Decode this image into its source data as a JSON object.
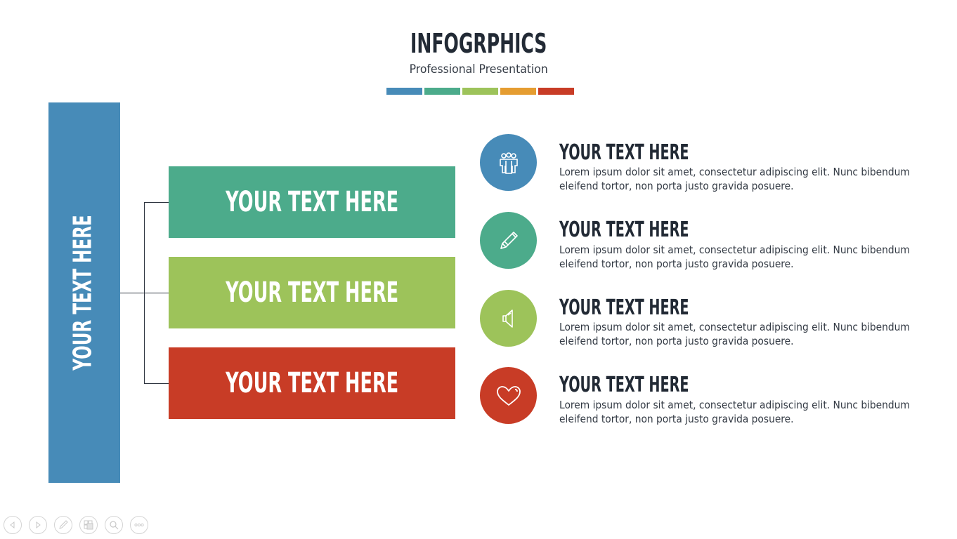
{
  "header": {
    "title": "INFOGRPHICS",
    "subtitle": "Professional Presentation"
  },
  "palette": [
    "#478bb8",
    "#4cab8b",
    "#9dc35a",
    "#e59d31",
    "#c83c26"
  ],
  "side_block": {
    "label": "YOUR TEXT HERE",
    "color": "#478bb8"
  },
  "boxes": [
    {
      "label": "YOUR TEXT HERE",
      "color": "#4cab8b"
    },
    {
      "label": "YOUR TEXT HERE",
      "color": "#9dc35a"
    },
    {
      "label": "YOUR TEXT HERE",
      "color": "#c83c26"
    }
  ],
  "items": [
    {
      "icon": "people-icon",
      "color": "#478bb8",
      "title": "YOUR TEXT HERE",
      "line1": "Lorem ipsum dolor sit amet, consectetur adipiscing elit. Nunc bibendum",
      "line2": "eleifend tortor, non porta justo gravida posuere."
    },
    {
      "icon": "pencil-icon",
      "color": "#4cab8b",
      "title": "YOUR TEXT HERE",
      "line1": "Lorem ipsum dolor sit amet, consectetur adipiscing elit. Nunc bibendum",
      "line2": "eleifend tortor, non porta justo gravida posuere."
    },
    {
      "icon": "speaker-icon",
      "color": "#9dc35a",
      "title": "YOUR TEXT HERE",
      "line1": "Lorem ipsum dolor sit amet, consectetur adipiscing elit. Nunc bibendum",
      "line2": "eleifend tortor, non porta justo gravida posuere."
    },
    {
      "icon": "heart-icon",
      "color": "#c83c26",
      "title": "YOUR TEXT HERE",
      "line1": "Lorem ipsum dolor sit amet, consectetur adipiscing elit. Nunc bibendum",
      "line2": "eleifend tortor, non porta justo gravida posuere."
    }
  ],
  "nav": [
    "previous-slide",
    "next-slide",
    "pen-tool",
    "slide-sorter",
    "zoom",
    "more-options"
  ]
}
